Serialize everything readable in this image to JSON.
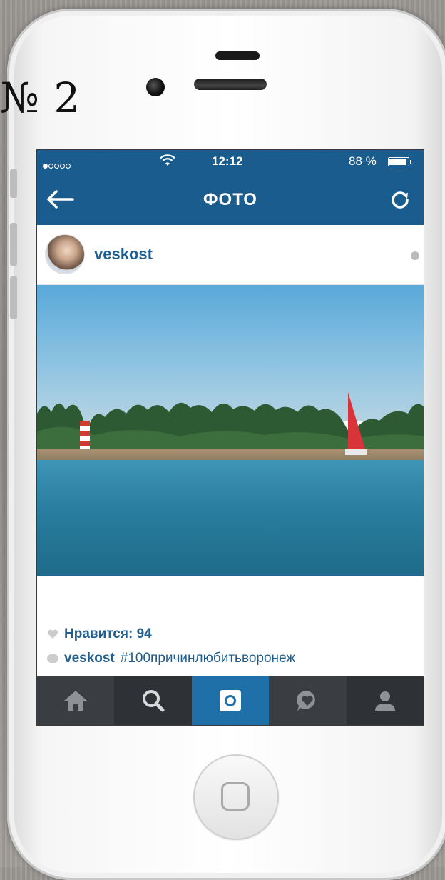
{
  "page_label": "№ 2",
  "status_bar": {
    "time": "12:12",
    "battery": "88 %",
    "battery_level_percent": 88,
    "signal_bars_filled": 1,
    "signal_bars_total": 5
  },
  "nav": {
    "title": "ФОТО",
    "back_icon": "arrow-left-icon",
    "refresh_icon": "refresh-icon"
  },
  "post": {
    "username": "veskost",
    "likes_label": "Нравится: 94",
    "caption_user": "veskost",
    "caption_text": "#100причинлюбитьворонеж"
  },
  "tabs": [
    {
      "icon": "home-icon"
    },
    {
      "icon": "search-icon"
    },
    {
      "icon": "camera-icon",
      "active": true
    },
    {
      "icon": "news-icon"
    },
    {
      "icon": "profile-icon"
    }
  ],
  "colors": {
    "header_blue": "#1b5c8e",
    "link_blue": "#1f5e8f",
    "tab_bar": "#2e3136",
    "tab_active": "#1f6fa8"
  }
}
